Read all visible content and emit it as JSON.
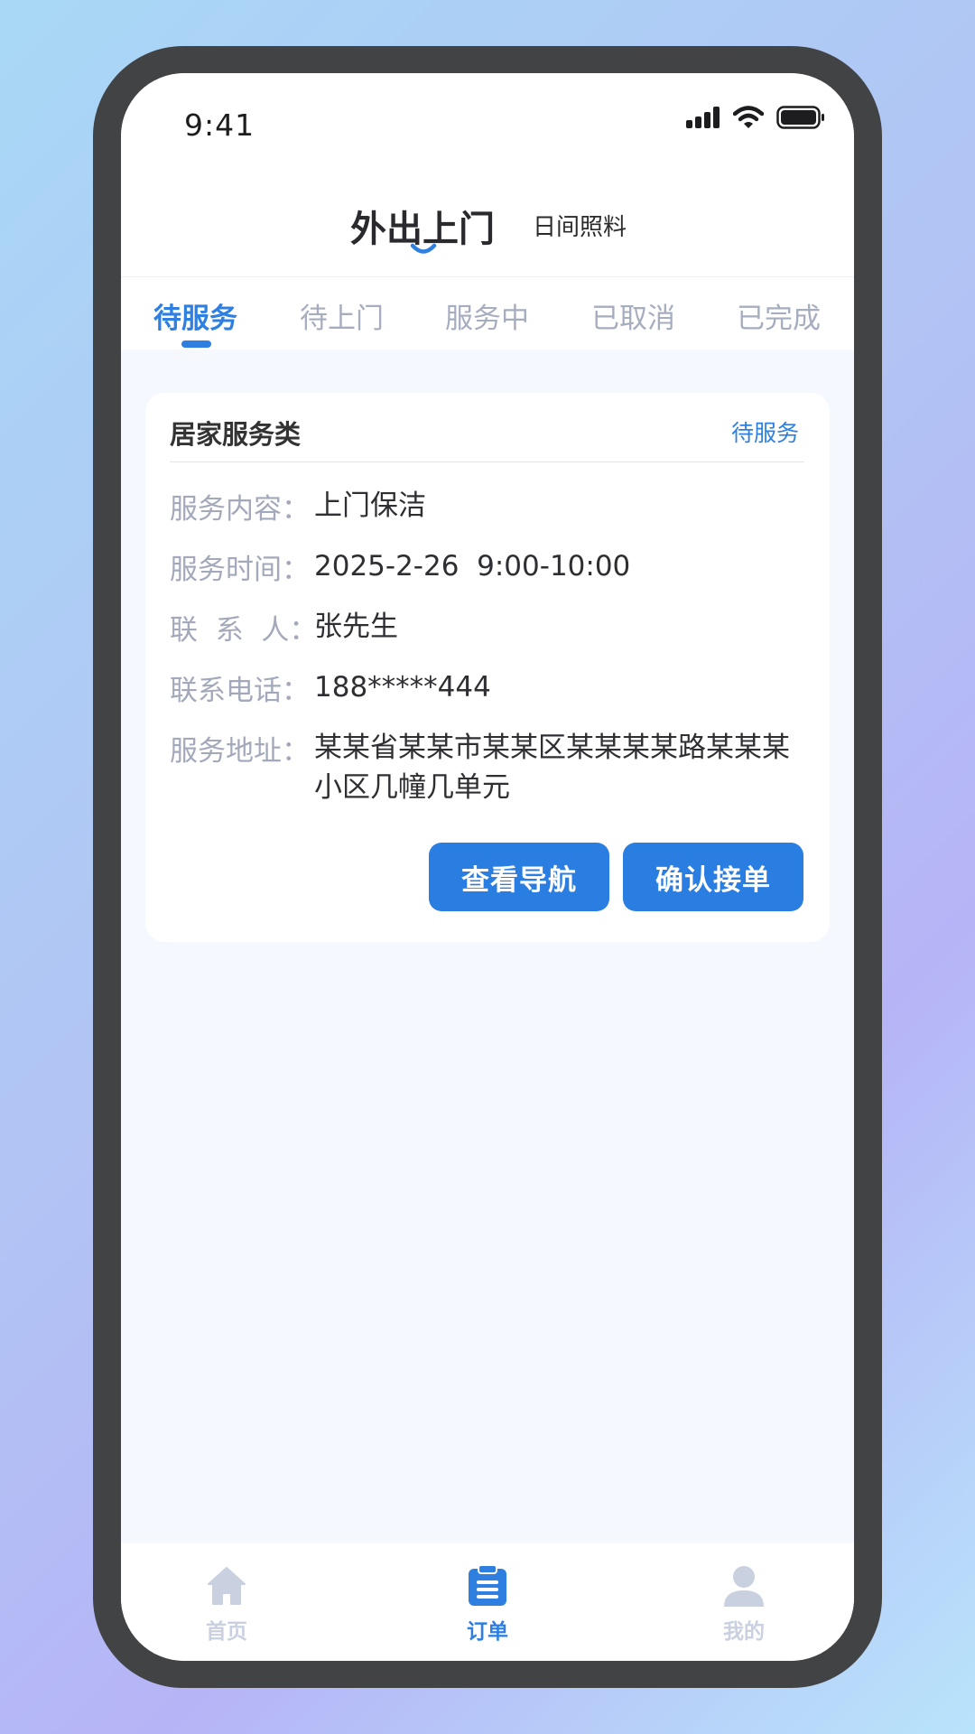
{
  "status_bar": {
    "time": "9:41",
    "icons": [
      "signal-icon",
      "wifi-icon",
      "battery-icon"
    ]
  },
  "header": {
    "title": "外出上门",
    "subtitle": "日间照料"
  },
  "tabs": [
    {
      "label": "待服务",
      "active": true
    },
    {
      "label": "待上门",
      "active": false
    },
    {
      "label": "服务中",
      "active": false
    },
    {
      "label": "已取消",
      "active": false
    },
    {
      "label": "已完成",
      "active": false
    }
  ],
  "order_card": {
    "category": "居家服务类",
    "status": "待服务",
    "fields": [
      {
        "label": "服务内容：",
        "value": "上门保洁"
      },
      {
        "label": "服务时间：",
        "value": "2025-2-26  9:00-10:00"
      },
      {
        "label": "联  系  人：",
        "value": "张先生"
      },
      {
        "label": "联系电话：",
        "value": "188*****444"
      },
      {
        "label": "服务地址：",
        "value": "某某省某某市某某区某某某某路某某某小区几幢几单元"
      }
    ],
    "buttons": {
      "navigate": "查看导航",
      "accept": "确认接单"
    }
  },
  "bottom_nav": [
    {
      "label": "首页",
      "icon": "home-icon",
      "active": false
    },
    {
      "label": "订单",
      "icon": "clipboard-icon",
      "active": true
    },
    {
      "label": "我的",
      "icon": "user-icon",
      "active": false
    }
  ],
  "colors": {
    "accent": "#2f7fe0",
    "button": "#2a7de1",
    "inactive": "#a6adbf",
    "frame": "#424345"
  }
}
